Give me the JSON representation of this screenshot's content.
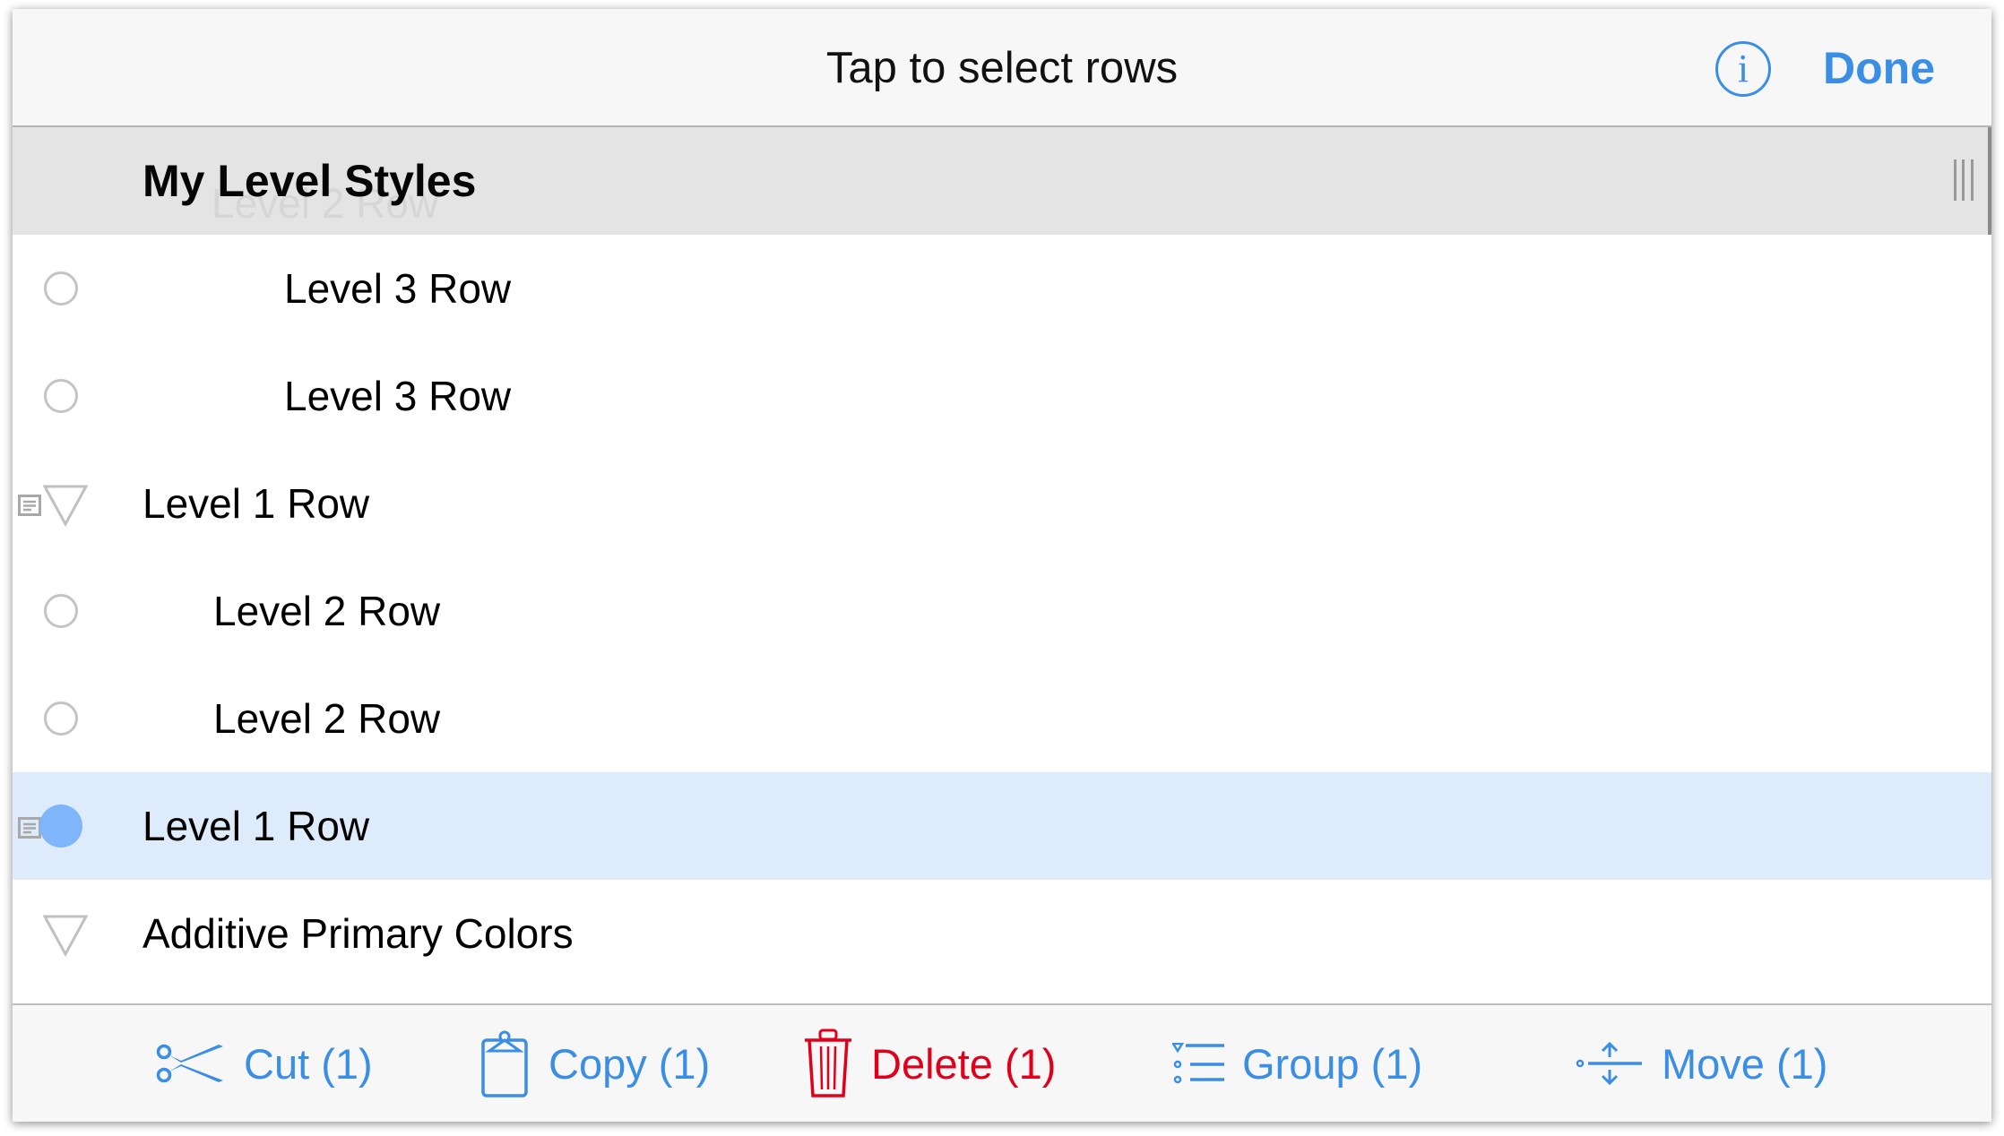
{
  "navbar": {
    "title": "Tap to select rows",
    "info_icon": "info-circle-icon",
    "done_label": "Done"
  },
  "section": {
    "title": "My Level Styles",
    "ghost_text": "Level 2 Row"
  },
  "rows": [
    {
      "label": "Level 3 Row",
      "level": 3,
      "control": "radio-empty",
      "has_note": false,
      "selected": false
    },
    {
      "label": "Level 3 Row",
      "level": 3,
      "control": "radio-empty",
      "has_note": false,
      "selected": false
    },
    {
      "label": "Level 1 Row",
      "level": 1,
      "control": "disclosure-triangle",
      "has_note": true,
      "selected": false
    },
    {
      "label": "Level 2 Row",
      "level": 2,
      "control": "radio-empty",
      "has_note": false,
      "selected": false
    },
    {
      "label": "Level 2 Row",
      "level": 2,
      "control": "radio-empty",
      "has_note": false,
      "selected": false
    },
    {
      "label": "Level 1 Row",
      "level": 1,
      "control": "radio-filled",
      "has_note": true,
      "selected": true
    },
    {
      "label": "Additive Primary Colors",
      "level": 1,
      "control": "disclosure-triangle",
      "has_note": false,
      "selected": false
    }
  ],
  "toolbar": {
    "cut": {
      "label": "Cut (1)",
      "icon": "scissors-icon"
    },
    "copy": {
      "label": "Copy (1)",
      "icon": "clipboard-icon"
    },
    "delete": {
      "label": "Delete (1)",
      "icon": "trash-icon"
    },
    "group": {
      "label": "Group (1)",
      "icon": "group-icon"
    },
    "move": {
      "label": "Move (1)",
      "icon": "move-icon"
    }
  },
  "colors": {
    "accent": "#3a8ee6",
    "destructive": "#e0001b",
    "selection": "#deebfb",
    "selected_dot": "#7fb5fb"
  }
}
